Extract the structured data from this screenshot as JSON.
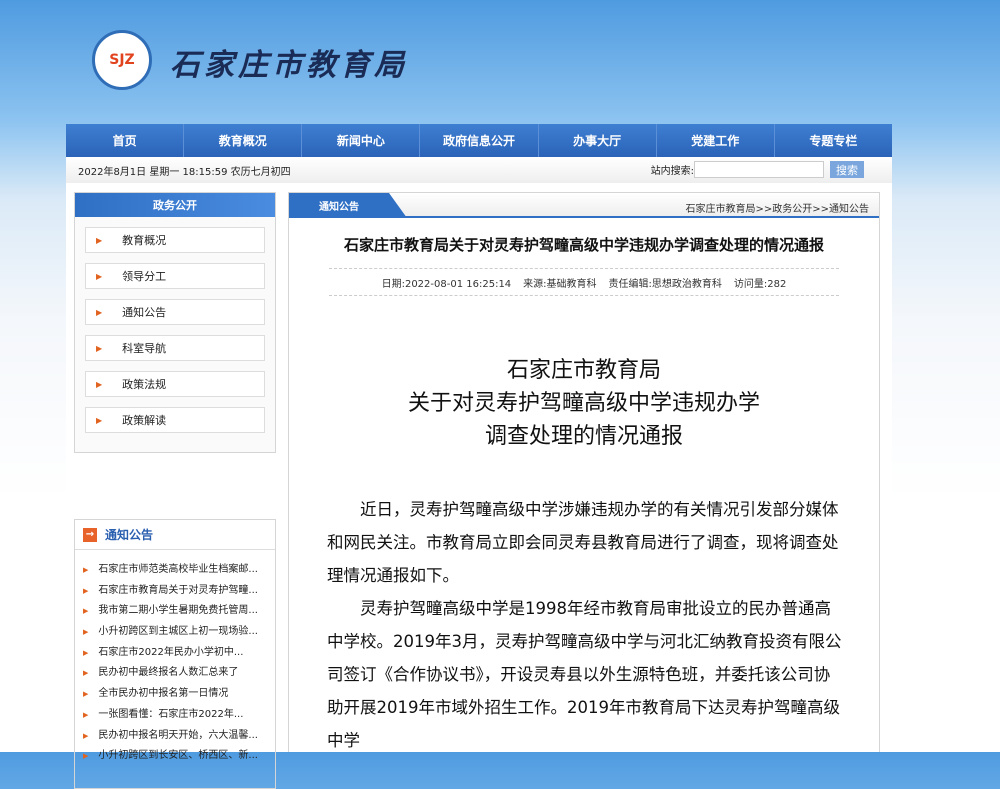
{
  "header": {
    "logo_text": "SJZ",
    "site_title": "石家庄市教育局"
  },
  "nav": [
    "首页",
    "教育概况",
    "新闻中心",
    "政府信息公开",
    "办事大厅",
    "党建工作",
    "专题专栏"
  ],
  "info": {
    "datetime": "2022年8月1日 星期一 18:15:59 农历七月初四",
    "search_label": "站内搜索:",
    "search_value": "",
    "search_button": "搜索"
  },
  "sidebar": {
    "title": "政务公开",
    "items": [
      "教育概况",
      "领导分工",
      "通知公告",
      "科室导航",
      "政策法规",
      "政策解读"
    ]
  },
  "notices": {
    "title": "通知公告",
    "items": [
      "石家庄市师范类高校毕业生档案邮...",
      "石家庄市教育局关于对灵寿护驾疃...",
      "我市第二期小学生暑期免费托管周...",
      "小升初跨区到主城区上初一现场验...",
      "石家庄市2022年民办小学初中...",
      "民办初中最终报名人数汇总来了",
      "全市民办初中报名第一日情况",
      "一张图看懂：石家庄市2022年...",
      "民办初中报名明天开始，六大温馨...",
      "小升初跨区到长安区、桥西区、新..."
    ]
  },
  "main": {
    "tab": "通知公告",
    "breadcrumb": "石家庄市教育局>>政务公开>>通知公告",
    "title": "石家庄市教育局关于对灵寿护驾疃高级中学违规办学调查处理的情况通报",
    "meta": {
      "date": "日期:2022-08-01 16:25:14",
      "source": "来源:基础教育科",
      "editor": "责任编辑:思想政治教育科",
      "views": "访问量:282"
    },
    "body_title": [
      "石家庄市教育局",
      "关于对灵寿护驾疃高级中学违规办学",
      "调查处理的情况通报"
    ],
    "paragraphs": [
      "近日，灵寿护驾疃高级中学涉嫌违规办学的有关情况引发部分媒体和网民关注。市教育局立即会同灵寿县教育局进行了调查，现将调查处理情况通报如下。",
      "灵寿护驾疃高级中学是1998年经市教育局审批设立的民办普通高中学校。2019年3月，灵寿护驾疃高级中学与河北汇纳教育投资有限公司签订《合作协议书》，开设灵寿县以外生源特色班，并委托该公司协助开展2019年市域外招生工作。2019年市教育局下达灵寿护驾疃高级中学"
    ]
  }
}
